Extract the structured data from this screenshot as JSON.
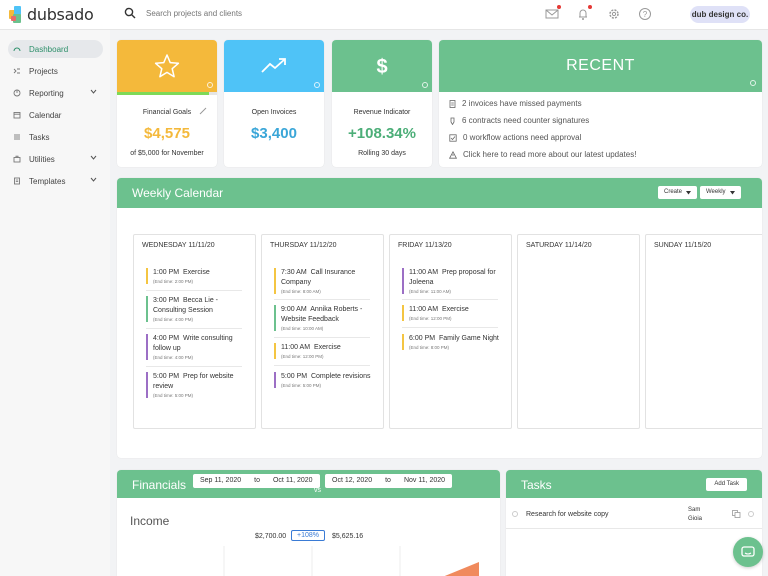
{
  "app": {
    "name": "dubsado"
  },
  "search": {
    "placeholder": "Search projects and clients"
  },
  "header": {
    "org_badge": "dub design co."
  },
  "sidebar": {
    "items": [
      {
        "label": "Dashboard",
        "active": true
      },
      {
        "label": "Projects"
      },
      {
        "label": "Reporting",
        "has_children": true
      },
      {
        "label": "Calendar"
      },
      {
        "label": "Tasks"
      },
      {
        "label": "Utilities",
        "has_children": true
      },
      {
        "label": "Templates",
        "has_children": true
      }
    ]
  },
  "stats": [
    {
      "label": "Financial Goals",
      "value": "$4,575",
      "sub": "of $5,000 for November",
      "color": "#f4b93b",
      "value_color": "#f4b93b",
      "icon": "star-icon",
      "progress": 0.915
    },
    {
      "label": "Open Invoices",
      "value": "$3,400",
      "sub": "",
      "color": "#4fc3f7",
      "value_color": "#3aa6d8",
      "icon": "trend-up-icon"
    },
    {
      "label": "Revenue Indicator",
      "value": "+108.34%",
      "sub": "Rolling 30 days",
      "color": "#6cc18e",
      "value_color": "#4cae78",
      "icon": "dollar-icon"
    }
  ],
  "recent": {
    "title": "RECENT",
    "items": [
      {
        "text": "2 invoices have missed payments",
        "icon": "invoice-icon"
      },
      {
        "text": "6 contracts need counter signatures",
        "icon": "pen-icon"
      },
      {
        "text": "0 workflow actions need approval",
        "icon": "checkbox-icon"
      },
      {
        "text": "Click here to read more about our latest updates!",
        "icon": "warning-icon"
      }
    ]
  },
  "calendar": {
    "title": "Weekly Calendar",
    "create_label": "Create",
    "view_label": "Weekly",
    "days": [
      {
        "header": "WEDNESDAY 11/11/20",
        "events": [
          {
            "time": "1:00 PM",
            "title": "Exercise",
            "end": "(End time: 2:00 PM)",
            "color": "#f4c542"
          },
          {
            "time": "3:00 PM",
            "title": "Becca Lie - Consulting Session",
            "end": "(End time: 4:00 PM)",
            "color": "#6cc18e"
          },
          {
            "time": "4:00 PM",
            "title": "Write consulting follow up",
            "end": "(End time: 4:00 PM)",
            "color": "#9c6fc5"
          },
          {
            "time": "5:00 PM",
            "title": "Prep for website review",
            "end": "(End time: 5:00 PM)",
            "color": "#9c6fc5"
          }
        ]
      },
      {
        "header": "THURSDAY 11/12/20",
        "events": [
          {
            "time": "7:30 AM",
            "title": "Call Insurance Company",
            "end": "(End time: 8:00 AM)",
            "color": "#f4c542"
          },
          {
            "time": "9:00 AM",
            "title": "Annika Roberts - Website Feedback",
            "end": "(End time: 10:00 AM)",
            "color": "#6cc18e"
          },
          {
            "time": "11:00 AM",
            "title": "Exercise",
            "end": "(End time: 12:00 PM)",
            "color": "#f4c542"
          },
          {
            "time": "5:00 PM",
            "title": "Complete revisions",
            "end": "(End time: 5:00 PM)",
            "color": "#9c6fc5"
          }
        ]
      },
      {
        "header": "FRIDAY 11/13/20",
        "events": [
          {
            "time": "11:00 AM",
            "title": "Prep proposal for Joleena",
            "end": "(End time: 11:00 AM)",
            "color": "#9c6fc5"
          },
          {
            "time": "11:00 AM",
            "title": "Exercise",
            "end": "(End time: 12:00 PM)",
            "color": "#f4c542"
          },
          {
            "time": "6:00 PM",
            "title": "Family Game Night",
            "end": "(End time: 8:00 PM)",
            "color": "#f4c542"
          }
        ]
      },
      {
        "header": "SATURDAY 11/14/20",
        "events": []
      },
      {
        "header": "SUNDAY 11/15/20",
        "events": []
      }
    ]
  },
  "financials": {
    "title": "Financials",
    "range1_start": "Sep 11, 2020",
    "range1_to": "to",
    "range1_end": "Oct 11, 2020",
    "vs": "vs",
    "range2_start": "Oct 12, 2020",
    "range2_to": "to",
    "range2_end": "Nov 11, 2020",
    "income_label": "Income",
    "income_prev": "$2,700.00",
    "income_change": "+108%",
    "income_curr": "$5,625.16"
  },
  "tasks": {
    "title": "Tasks",
    "add_label": "Add Task",
    "items": [
      {
        "title": "Research for website copy",
        "assignee": "Sam Gioia"
      }
    ]
  }
}
